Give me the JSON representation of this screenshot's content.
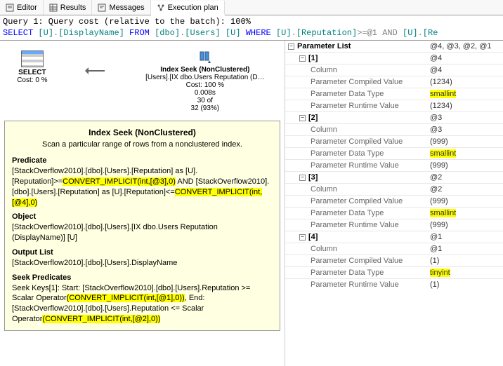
{
  "tabs": [
    {
      "label": "Editor"
    },
    {
      "label": "Results"
    },
    {
      "label": "Messages"
    },
    {
      "label": "Execution plan"
    }
  ],
  "active_tab": 3,
  "query_header": "Query 1: Query cost (relative to the batch): 100%",
  "query_sql_parts": {
    "p1": "SELECT ",
    "p2": "[U]",
    "p3": ".",
    "p4": "[DisplayName]",
    "p5": " FROM ",
    "p6": "[dbo]",
    "p7": ".",
    "p8": "[Users]",
    "p9": " ",
    "p10": "[U]",
    "p11": " WHERE ",
    "p12": "[U]",
    "p13": ".",
    "p14": "[Reputation]",
    "p15": ">=@1",
    "p16": " AND ",
    "p17": "[U]",
    "p18": ".",
    "p19": "[Re"
  },
  "plan_select": {
    "label": "SELECT",
    "cost": "Cost: 0 %"
  },
  "plan_seek": {
    "title": "Index Seek (NonClustered)",
    "obj": "[Users].[IX dbo.Users Reputation (D…",
    "cost": "Cost: 100 %",
    "time": "0.008s",
    "rows": "30 of",
    "rows2": "32 (93%)"
  },
  "tooltip": {
    "title": "Index Seek (NonClustered)",
    "desc": "Scan a particular range of rows from a nonclustered index.",
    "predicate_title": "Predicate",
    "pred_a": "[StackOverflow2010].[dbo].[Users].[Reputation] as [U].[Reputation]>=",
    "pred_hl1": "CONVERT_IMPLICIT(int,[@3],0)",
    "pred_b": " AND [StackOverflow2010].[dbo].[Users].[Reputation] as [U].[Reputation]<=",
    "pred_hl2": "CONVERT_IMPLICIT(int,[@4],0)",
    "object_title": "Object",
    "object": "[StackOverflow2010].[dbo].[Users].[IX dbo.Users Reputation (DisplayName)] [U]",
    "outlist_title": "Output List",
    "outlist": "[StackOverflow2010].[dbo].[Users].DisplayName",
    "seek_title": "Seek Predicates",
    "seek_a": "Seek Keys[1]: Start: [StackOverflow2010].[dbo].[Users].Reputation >= Scalar Operator",
    "seek_hl1": "(CONVERT_IMPLICIT(int,[@1],0))",
    "seek_b": ", End: [StackOverflow2010].[dbo].[Users].Reputation <= Scalar Operator",
    "seek_hl2": "(CONVERT_IMPLICIT(int,[@2],0))"
  },
  "props": {
    "param_list_label": "Parameter List",
    "param_list_val": "@4, @3, @2, @1",
    "col_label": "Column",
    "pcv_label": "Parameter Compiled Value",
    "pdt_label": "Parameter Data Type",
    "prv_label": "Parameter Runtime Value",
    "items": [
      {
        "idx": "[1]",
        "name": "@4",
        "col": "@4",
        "pcv": "(1234)",
        "pdt": "smallint",
        "prv": "(1234)"
      },
      {
        "idx": "[2]",
        "name": "@3",
        "col": "@3",
        "pcv": "(999)",
        "pdt": "smallint",
        "prv": "(999)"
      },
      {
        "idx": "[3]",
        "name": "@2",
        "col": "@2",
        "pcv": "(999)",
        "pdt": "smallint",
        "prv": "(999)"
      },
      {
        "idx": "[4]",
        "name": "@1",
        "col": "@1",
        "pcv": "(1)",
        "pdt": "tinyint",
        "prv": "(1)"
      }
    ]
  }
}
